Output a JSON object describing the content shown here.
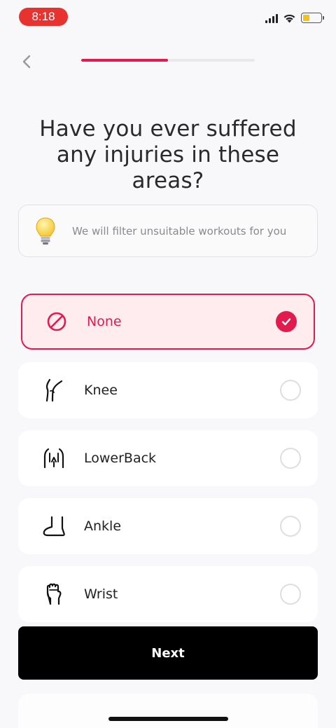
{
  "status_bar": {
    "time": "8:18"
  },
  "onboarding": {
    "progress": 0.5
  },
  "title": "Have you ever suffered any injuries in these areas?",
  "tip": {
    "text": "We will filter unsuitable workouts for you"
  },
  "options": [
    {
      "label": "None",
      "icon": "no-icon",
      "selected": true
    },
    {
      "label": "Knee",
      "icon": "knee-icon",
      "selected": false
    },
    {
      "label": "LowerBack",
      "icon": "lower-back-icon",
      "selected": false
    },
    {
      "label": "Ankle",
      "icon": "ankle-icon",
      "selected": false
    },
    {
      "label": "Wrist",
      "icon": "wrist-icon",
      "selected": false
    }
  ],
  "next_label": "Next",
  "colors": {
    "accent": "#e31a4d",
    "selected_bg": "#ffecee",
    "time_pill": "#e8322f"
  }
}
